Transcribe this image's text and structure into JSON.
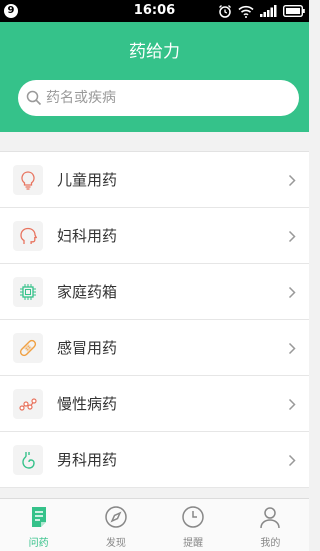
{
  "status_bar": {
    "badge": "9",
    "time": "16:06"
  },
  "header": {
    "title": "药给力"
  },
  "search": {
    "placeholder": "药名或疾病"
  },
  "categories": [
    {
      "label": "儿童用药",
      "icon": "lightbulb-icon"
    },
    {
      "label": "妇科用药",
      "icon": "head-profile-icon"
    },
    {
      "label": "家庭药箱",
      "icon": "chip-icon"
    },
    {
      "label": "感冒用药",
      "icon": "bandage-icon"
    },
    {
      "label": "慢性病药",
      "icon": "molecule-icon"
    },
    {
      "label": "男科用药",
      "icon": "stomach-icon"
    }
  ],
  "tabs": [
    {
      "label": "问药",
      "active": true
    },
    {
      "label": "发现",
      "active": false
    },
    {
      "label": "提醒",
      "active": false
    },
    {
      "label": "我的",
      "active": false
    }
  ],
  "colors": {
    "accent": "#35c28a",
    "icon_red": "#e8735e",
    "icon_green": "#35c28a",
    "icon_orange": "#f0a042"
  }
}
